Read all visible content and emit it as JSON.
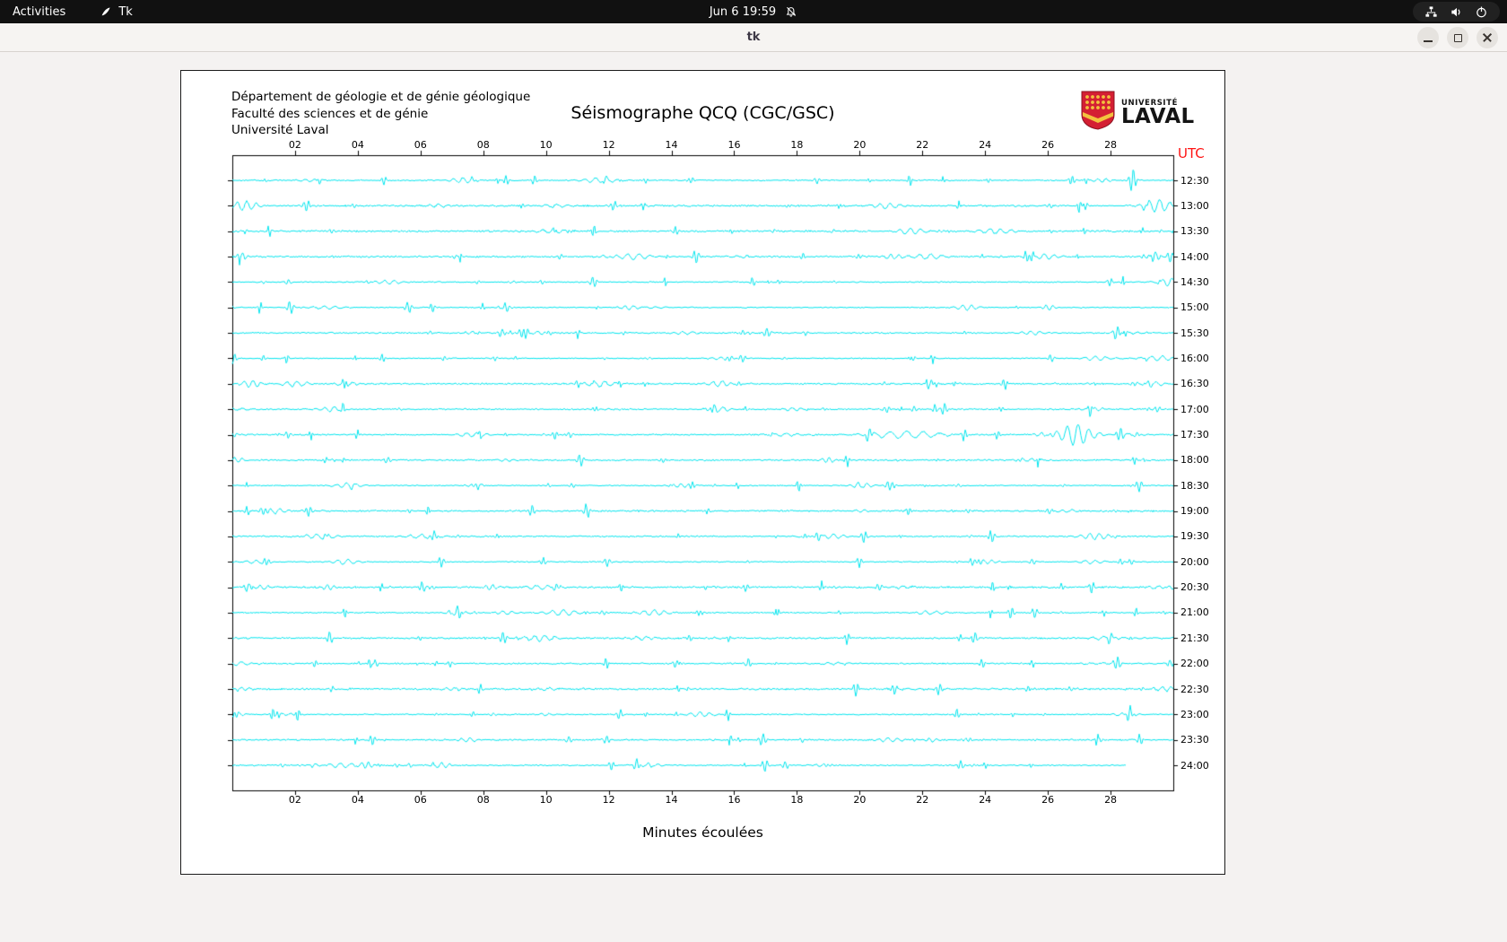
{
  "topbar": {
    "activities_label": "Activities",
    "app_label": "Tk",
    "clock": "Jun 6 19:59"
  },
  "titlebar": {
    "title": "tk"
  },
  "plot": {
    "header_lines": [
      "Département de géologie et de génie géologique",
      "Faculté des sciences et de génie",
      "Université Laval"
    ],
    "title": "Séismographe QCQ (CGC/GSC)",
    "logo_line1": "UNIVERSITÉ",
    "logo_line2": "LAVAL",
    "utc_label": "UTC",
    "xlabel": "Minutes écoulées"
  },
  "chart_data": {
    "type": "line",
    "subtype": "helicorder-seismogram",
    "title": "Séismographe QCQ (CGC/GSC)",
    "xlabel": "Minutes écoulées",
    "x_range_minutes": [
      0,
      30
    ],
    "x_ticks": [
      "02",
      "04",
      "06",
      "08",
      "10",
      "12",
      "14",
      "16",
      "18",
      "20",
      "22",
      "24",
      "26",
      "28"
    ],
    "row_times_utc": [
      "12:30",
      "13:00",
      "13:30",
      "14:00",
      "14:30",
      "15:00",
      "15:30",
      "16:00",
      "16:30",
      "17:00",
      "17:30",
      "18:00",
      "18:30",
      "19:00",
      "19:30",
      "20:00",
      "20:30",
      "21:00",
      "21:30",
      "22:00",
      "22:30",
      "23:00",
      "23:30",
      "24:00"
    ],
    "utc_axis_label": "UTC",
    "trace_color": "#00e5ee",
    "utc_label_color": "#ff1414",
    "last_row_end_minute": 28.5,
    "events": [
      {
        "row": "12:30",
        "minute": 28.7,
        "amp": 14,
        "width": 0.08
      },
      {
        "row": "13:00",
        "minute": 0.4,
        "amp": 5,
        "width": 0.3
      },
      {
        "row": "13:00",
        "minute": 29.5,
        "amp": 7,
        "width": 0.35
      },
      {
        "row": "14:00",
        "minute": 0.3,
        "amp": 5,
        "width": 0.1
      },
      {
        "row": "14:00",
        "minute": 29.4,
        "amp": 6,
        "width": 0.12
      },
      {
        "row": "15:30",
        "minute": 28.2,
        "amp": 8,
        "width": 0.08
      },
      {
        "row": "16:30",
        "minute": 0.6,
        "amp": 4,
        "width": 0.25
      },
      {
        "row": "17:30",
        "minute": 21.4,
        "amp": 4,
        "width": 0.9
      },
      {
        "row": "17:30",
        "minute": 26.9,
        "amp": 12,
        "width": 0.38
      },
      {
        "row": "17:30",
        "minute": 28.3,
        "amp": 8,
        "width": 0.08
      },
      {
        "row": "20:30",
        "minute": 0.5,
        "amp": 5,
        "width": 0.1
      },
      {
        "row": "21:30",
        "minute": 28.0,
        "amp": 6,
        "width": 0.08
      },
      {
        "row": "22:00",
        "minute": 28.2,
        "amp": 7,
        "width": 0.08
      },
      {
        "row": "23:00",
        "minute": 28.6,
        "amp": 9,
        "width": 0.07
      },
      {
        "row": "23:30",
        "minute": 16.9,
        "amp": 7,
        "width": 0.08
      },
      {
        "row": "24:00",
        "minute": 4.3,
        "amp": 4,
        "width": 0.15
      },
      {
        "row": "24:00",
        "minute": 6.6,
        "amp": 4,
        "width": 0.2
      }
    ]
  }
}
